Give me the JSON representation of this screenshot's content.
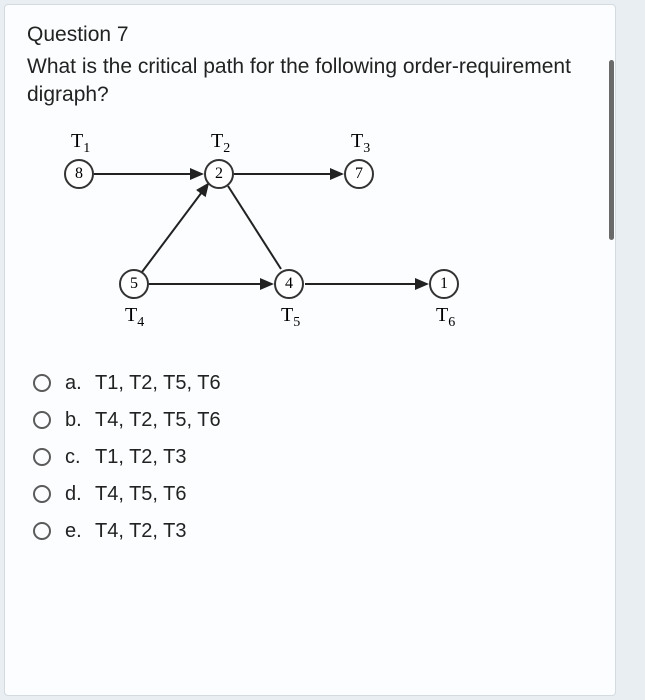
{
  "question": {
    "number_label": "Question 7",
    "prompt": "What is the critical path for the following order-requirement digraph?"
  },
  "digraph": {
    "tasks": {
      "T1": {
        "label_html": "T<sub>1</sub>",
        "value": "8"
      },
      "T2": {
        "label_html": "T<sub>2</sub>",
        "value": "2"
      },
      "T3": {
        "label_html": "T<sub>3</sub>",
        "value": "7"
      },
      "T4": {
        "label_html": "T<sub>4</sub>",
        "value": "5"
      },
      "T5": {
        "label_html": "T<sub>5</sub>",
        "value": "4"
      },
      "T6": {
        "label_html": "T<sub>6</sub>",
        "value": "1"
      }
    },
    "edges": [
      {
        "from": "T1",
        "to": "T2"
      },
      {
        "from": "T2",
        "to": "T3"
      },
      {
        "from": "T4",
        "to": "T2"
      },
      {
        "from": "T4",
        "to": "T5"
      },
      {
        "from": "T5",
        "to": "T6"
      }
    ]
  },
  "options": [
    {
      "letter": "a.",
      "text": "T1, T2, T5, T6"
    },
    {
      "letter": "b.",
      "text": "T4, T2, T5, T6"
    },
    {
      "letter": "c.",
      "text": "T1, T2, T3"
    },
    {
      "letter": "d.",
      "text": "T4, T5, T6"
    },
    {
      "letter": "e.",
      "text": "T4, T2, T3"
    }
  ]
}
